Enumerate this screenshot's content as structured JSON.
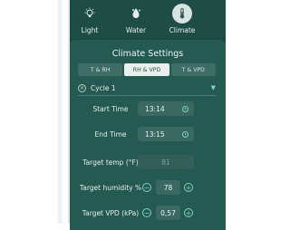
{
  "nav": {
    "items": [
      {
        "label": "Light",
        "icon": "light-bulb-icon",
        "active": false
      },
      {
        "label": "Water",
        "icon": "water-drops-icon",
        "active": false
      },
      {
        "label": "Climate",
        "icon": "thermometer-icon",
        "active": true
      }
    ]
  },
  "settings": {
    "title": "Climate Settings",
    "tabs": [
      {
        "label": "T & RH",
        "active": false
      },
      {
        "label": "RH & VPD",
        "active": true
      },
      {
        "label": "T & VPD",
        "active": false
      }
    ],
    "cycle": {
      "label": "Cycle 1"
    },
    "start_time": {
      "label": "Start Time",
      "value": "13:14"
    },
    "end_time": {
      "label": "End Time",
      "value": "13:15"
    },
    "target_temp": {
      "label": "Target temp (°F)",
      "value": "81"
    },
    "target_humidity": {
      "label": "Target humidity %",
      "value": "78",
      "minus": "−",
      "plus": "+"
    },
    "target_vpd": {
      "label": "Target VPD (kPa)",
      "value": "0,57",
      "minus": "−",
      "plus": "+"
    }
  },
  "colors": {
    "panel": "#1c4a42",
    "card": "#245a51",
    "accent": "#7fd3c2"
  }
}
